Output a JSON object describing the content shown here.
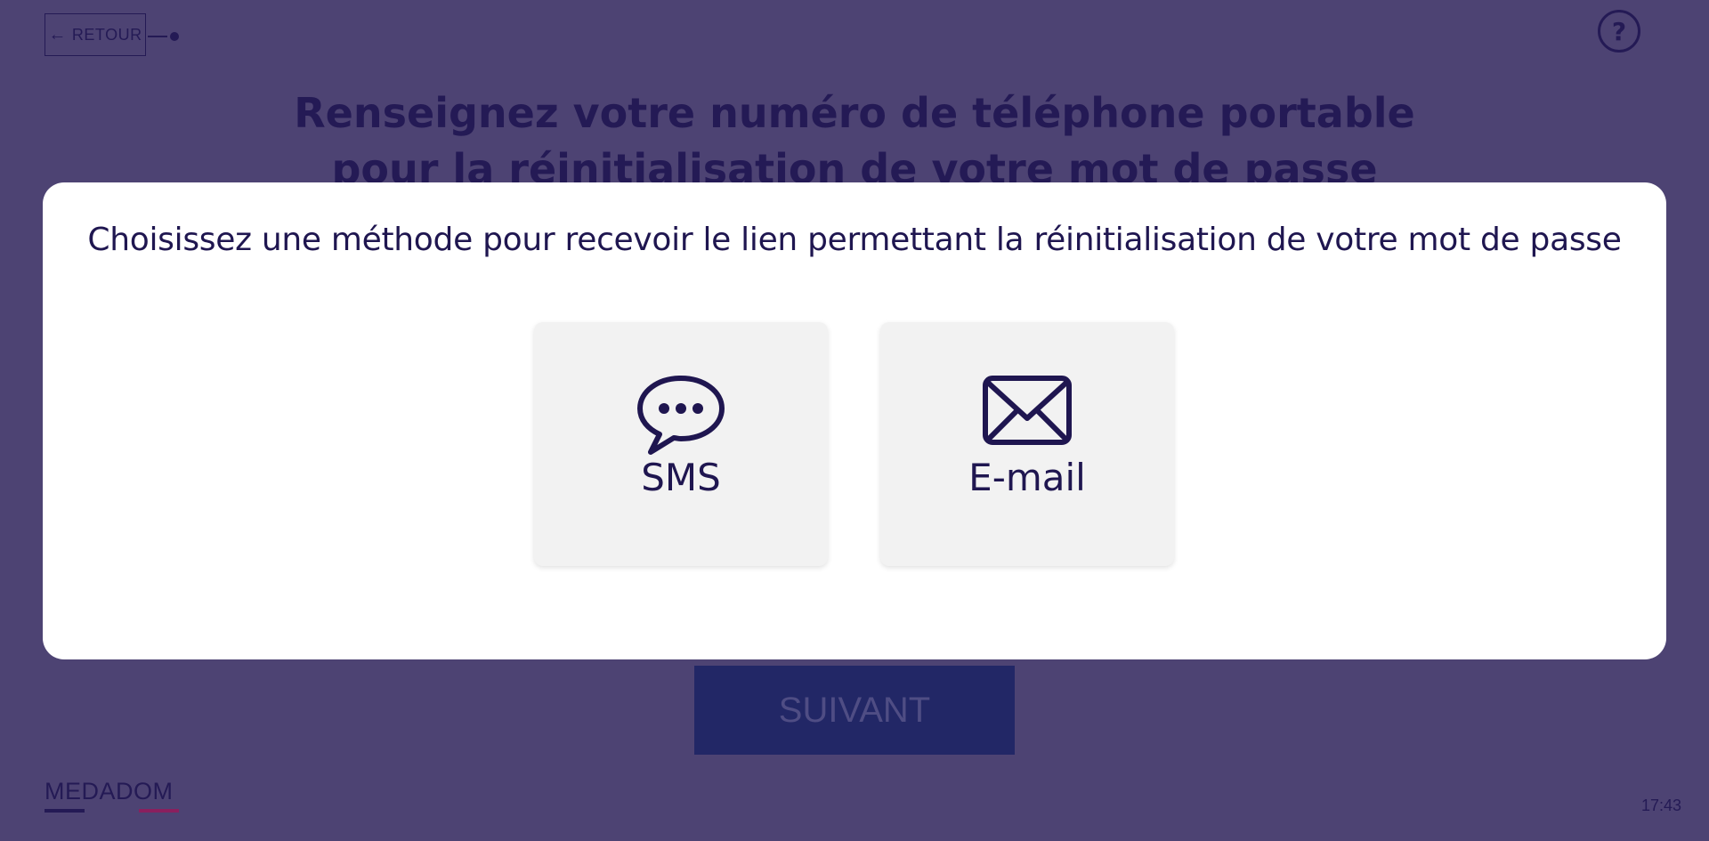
{
  "header": {
    "back_label": "RETOUR",
    "back_icon": "arrow-left-icon",
    "help_label": "?",
    "help_icon": "help-circle-icon"
  },
  "page": {
    "title_line1": "Renseignez votre numéro de téléphone portable",
    "title_line2": "pour la réinitialisation de votre mot de passe",
    "next_label": "SUIVANT"
  },
  "footer": {
    "logo_text": "MEDADOM",
    "clock": "17:43"
  },
  "modal": {
    "title": "Choisissez une méthode pour recevoir le lien permettant la réinitialisation de votre mot de passe",
    "options": [
      {
        "label": "SMS",
        "icon": "speech-bubble-icon"
      },
      {
        "label": "E-mail",
        "icon": "envelope-icon"
      }
    ]
  },
  "colors": {
    "background": "#4d4373",
    "primary": "#241a55",
    "modal_text": "#1f1650",
    "card": "#f2f2f2",
    "next_button": "#222766",
    "logo_accent": "#8a1f5e"
  }
}
